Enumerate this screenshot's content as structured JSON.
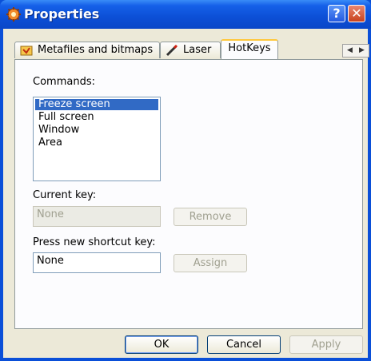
{
  "window": {
    "title": "Properties",
    "help_glyph": "?",
    "close_glyph": "✕"
  },
  "tabs": [
    {
      "label": "Metafiles and bitmaps",
      "icon": "folder-icon"
    },
    {
      "label": "Laser",
      "icon": "laser-pen-icon"
    },
    {
      "label": "HotKeys",
      "active": true
    }
  ],
  "tab_scroll": {
    "left_glyph": "◀",
    "right_glyph": "▶"
  },
  "hotkeys": {
    "commands_label": "Commands:",
    "commands": [
      "Freeze screen",
      "Full screen",
      "Window",
      "Area"
    ],
    "selected_command": "Freeze screen",
    "current_key_label": "Current key:",
    "current_key_value": "None",
    "remove_label": "Remove",
    "new_key_label": "Press new shortcut key:",
    "new_key_value": "None",
    "assign_label": "Assign"
  },
  "footer": {
    "ok_label": "OK",
    "cancel_label": "Cancel",
    "apply_label": "Apply"
  },
  "colors": {
    "titlebar": "#0a4fd8",
    "face": "#ece9d8",
    "selection": "#316ac5",
    "active_tab_accent": "#ffc83c"
  }
}
